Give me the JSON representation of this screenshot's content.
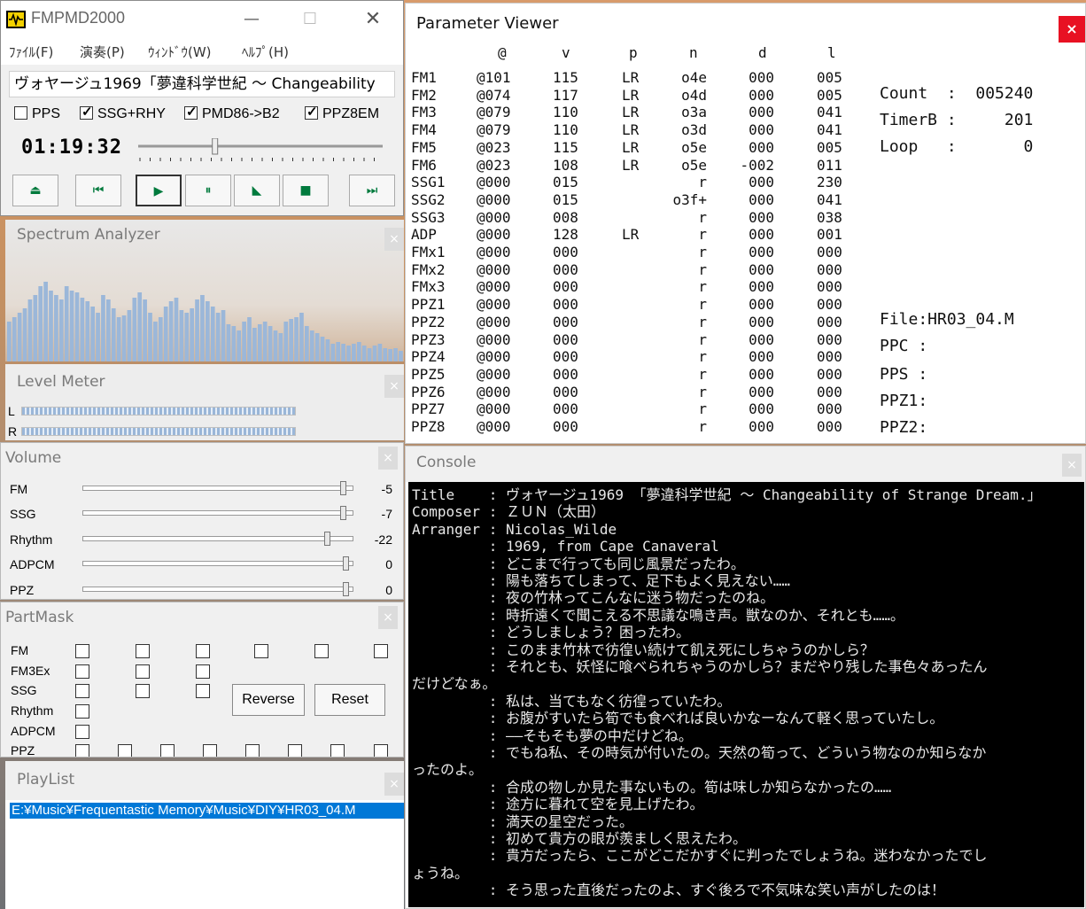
{
  "main": {
    "title": "FMPMD2000",
    "menu": [
      "ﾌｧｲﾙ(F)",
      "演奏(P)",
      "ｳｨﾝﾄﾞｳ(W)",
      "ﾍﾙﾌﾟ(H)"
    ],
    "song_title": "ヴォヤージュ1969「夢違科学世紀 〜 Changeability",
    "checkboxes": [
      {
        "label": "PPS",
        "checked": false
      },
      {
        "label": "SSG+RHY",
        "checked": true
      },
      {
        "label": "PMD86->B2",
        "checked": true
      },
      {
        "label": "PPZ8EM",
        "checked": true
      }
    ],
    "time": "01:19:32",
    "seek_position": 0.31,
    "transport": [
      "eject",
      "prev",
      "play",
      "pause",
      "fast-forward",
      "stop",
      "next"
    ]
  },
  "spectrum": {
    "title": "Spectrum Analyzer",
    "bars": [
      0.45,
      0.5,
      0.55,
      0.6,
      0.7,
      0.75,
      0.85,
      0.9,
      0.8,
      0.75,
      0.7,
      0.85,
      0.8,
      0.78,
      0.72,
      0.68,
      0.62,
      0.55,
      0.75,
      0.7,
      0.6,
      0.5,
      0.52,
      0.58,
      0.72,
      0.78,
      0.7,
      0.55,
      0.45,
      0.5,
      0.62,
      0.68,
      0.72,
      0.58,
      0.55,
      0.6,
      0.7,
      0.75,
      0.68,
      0.62,
      0.55,
      0.58,
      0.42,
      0.4,
      0.35,
      0.45,
      0.5,
      0.38,
      0.42,
      0.45,
      0.4,
      0.35,
      0.32,
      0.45,
      0.48,
      0.5,
      0.55,
      0.4,
      0.35,
      0.32,
      0.28,
      0.25,
      0.2,
      0.22,
      0.2,
      0.18,
      0.2,
      0.22,
      0.18,
      0.15,
      0.18,
      0.2,
      0.15,
      0.14,
      0.15,
      0.12
    ]
  },
  "level": {
    "title": "Level Meter",
    "left_label": "L",
    "right_label": "R",
    "left_level": 0.72,
    "right_level": 0.72
  },
  "volume": {
    "title": "Volume",
    "rows": [
      {
        "label": "FM",
        "value": "-5",
        "pos": 0.98
      },
      {
        "label": "SSG",
        "value": "-7",
        "pos": 0.98
      },
      {
        "label": "Rhythm",
        "value": "-22",
        "pos": 0.92
      },
      {
        "label": "ADPCM",
        "value": "0",
        "pos": 0.99
      },
      {
        "label": "PPZ",
        "value": "0",
        "pos": 0.99
      }
    ]
  },
  "partmask": {
    "title": "PartMask",
    "rows": [
      "FM",
      "FM3Ex",
      "SSG",
      "Rhythm",
      "ADPCM",
      "PPZ"
    ],
    "reverse": "Reverse",
    "reset": "Reset"
  },
  "playlist": {
    "title": "PlayList",
    "items": [
      "E:¥Music¥Frequentastic Memory¥Music¥DIY¥HR03_04.M"
    ]
  },
  "param": {
    "title": "Parameter Viewer",
    "close": "×",
    "headers": [
      "@",
      "v",
      "p",
      "n",
      "d",
      "l"
    ],
    "rows": [
      [
        "FM1",
        "@101",
        "115",
        "LR",
        "o4e",
        "000",
        "005"
      ],
      [
        "FM2",
        "@074",
        "117",
        "LR",
        "o4d",
        "000",
        "005"
      ],
      [
        "FM3",
        "@079",
        "110",
        "LR",
        "o3a",
        "000",
        "041"
      ],
      [
        "FM4",
        "@079",
        "110",
        "LR",
        "o3d",
        "000",
        "041"
      ],
      [
        "FM5",
        "@023",
        "115",
        "LR",
        "o5e",
        "000",
        "005"
      ],
      [
        "FM6",
        "@023",
        "108",
        "LR",
        "o5e",
        "-002",
        "011"
      ],
      [
        "SSG1",
        "@000",
        "015",
        "",
        "r",
        "000",
        "230"
      ],
      [
        "SSG2",
        "@000",
        "015",
        "",
        "o3f+",
        "000",
        "041"
      ],
      [
        "SSG3",
        "@000",
        "008",
        "",
        "r",
        "000",
        "038"
      ],
      [
        "ADP",
        "@000",
        "128",
        "LR",
        "r",
        "000",
        "001"
      ],
      [
        "FMx1",
        "@000",
        "000",
        "",
        "r",
        "000",
        "000"
      ],
      [
        "FMx2",
        "@000",
        "000",
        "",
        "r",
        "000",
        "000"
      ],
      [
        "FMx3",
        "@000",
        "000",
        "",
        "r",
        "000",
        "000"
      ],
      [
        "PPZ1",
        "@000",
        "000",
        "",
        "r",
        "000",
        "000"
      ],
      [
        "PPZ2",
        "@000",
        "000",
        "",
        "r",
        "000",
        "000"
      ],
      [
        "PPZ3",
        "@000",
        "000",
        "",
        "r",
        "000",
        "000"
      ],
      [
        "PPZ4",
        "@000",
        "000",
        "",
        "r",
        "000",
        "000"
      ],
      [
        "PPZ5",
        "@000",
        "000",
        "",
        "r",
        "000",
        "000"
      ],
      [
        "PPZ6",
        "@000",
        "000",
        "",
        "r",
        "000",
        "000"
      ],
      [
        "PPZ7",
        "@000",
        "000",
        "",
        "r",
        "000",
        "000"
      ],
      [
        "PPZ8",
        "@000",
        "000",
        "",
        "r",
        "000",
        "000"
      ]
    ],
    "count": "Count  :  005240",
    "timerb": "TimerB :     201",
    "loop": "Loop   :       0",
    "file": "File:HR03_04.M",
    "ppc": "PPC :",
    "pps": "PPS :",
    "ppz1": "PPZ1:",
    "ppz2": "PPZ2:"
  },
  "console": {
    "title": "Console",
    "lines": [
      "Title    : ヴォヤージュ1969 「夢違科学世紀 〜 Changeability of Strange Dream.」",
      "Composer : ＺＵＮ（太田）",
      "Arranger : Nicolas_Wilde",
      "         : 1969, from Cape Canaveral",
      "         : どこまで行っても同じ風景だったわ。",
      "         : 陽も落ちてしまって、足下もよく見えない……",
      "         : 夜の竹林ってこんなに迷う物だったのね。",
      "         : 時折遠くで聞こえる不思議な鳴き声。獣なのか、それとも……。",
      "         : どうしましょう？困ったわ。",
      "         : このまま竹林で彷徨い続けて飢え死にしちゃうのかしら？",
      "         : それとも、妖怪に喰べられちゃうのかしら？まだやり残した事色々あったん",
      "だけどなぁ。",
      "         : 私は、当てもなく彷徨っていたわ。",
      "         : お腹がすいたら筍でも食べれば良いかなーなんて軽く思っていたし。",
      "         : ――そもそも夢の中だけどね。",
      "         : でもね私、その時気が付いたの。天然の筍って、どういう物なのか知らなか",
      "ったのよ。",
      "         : 合成の物しか見た事ないもの。筍は味しか知らなかったの……",
      "         : 途方に暮れて空を見上げたわ。",
      "         : 満天の星空だった。",
      "         : 初めて貴方の眼が羨ましく思えたわ。",
      "         : 貴方だったら、ここがどこだかすぐに判ったでしょうね。迷わなかったでし",
      "ょうね。",
      "         : そう思った直後だったのよ、すぐ後ろで不気味な笑い声がしたのは！"
    ]
  }
}
